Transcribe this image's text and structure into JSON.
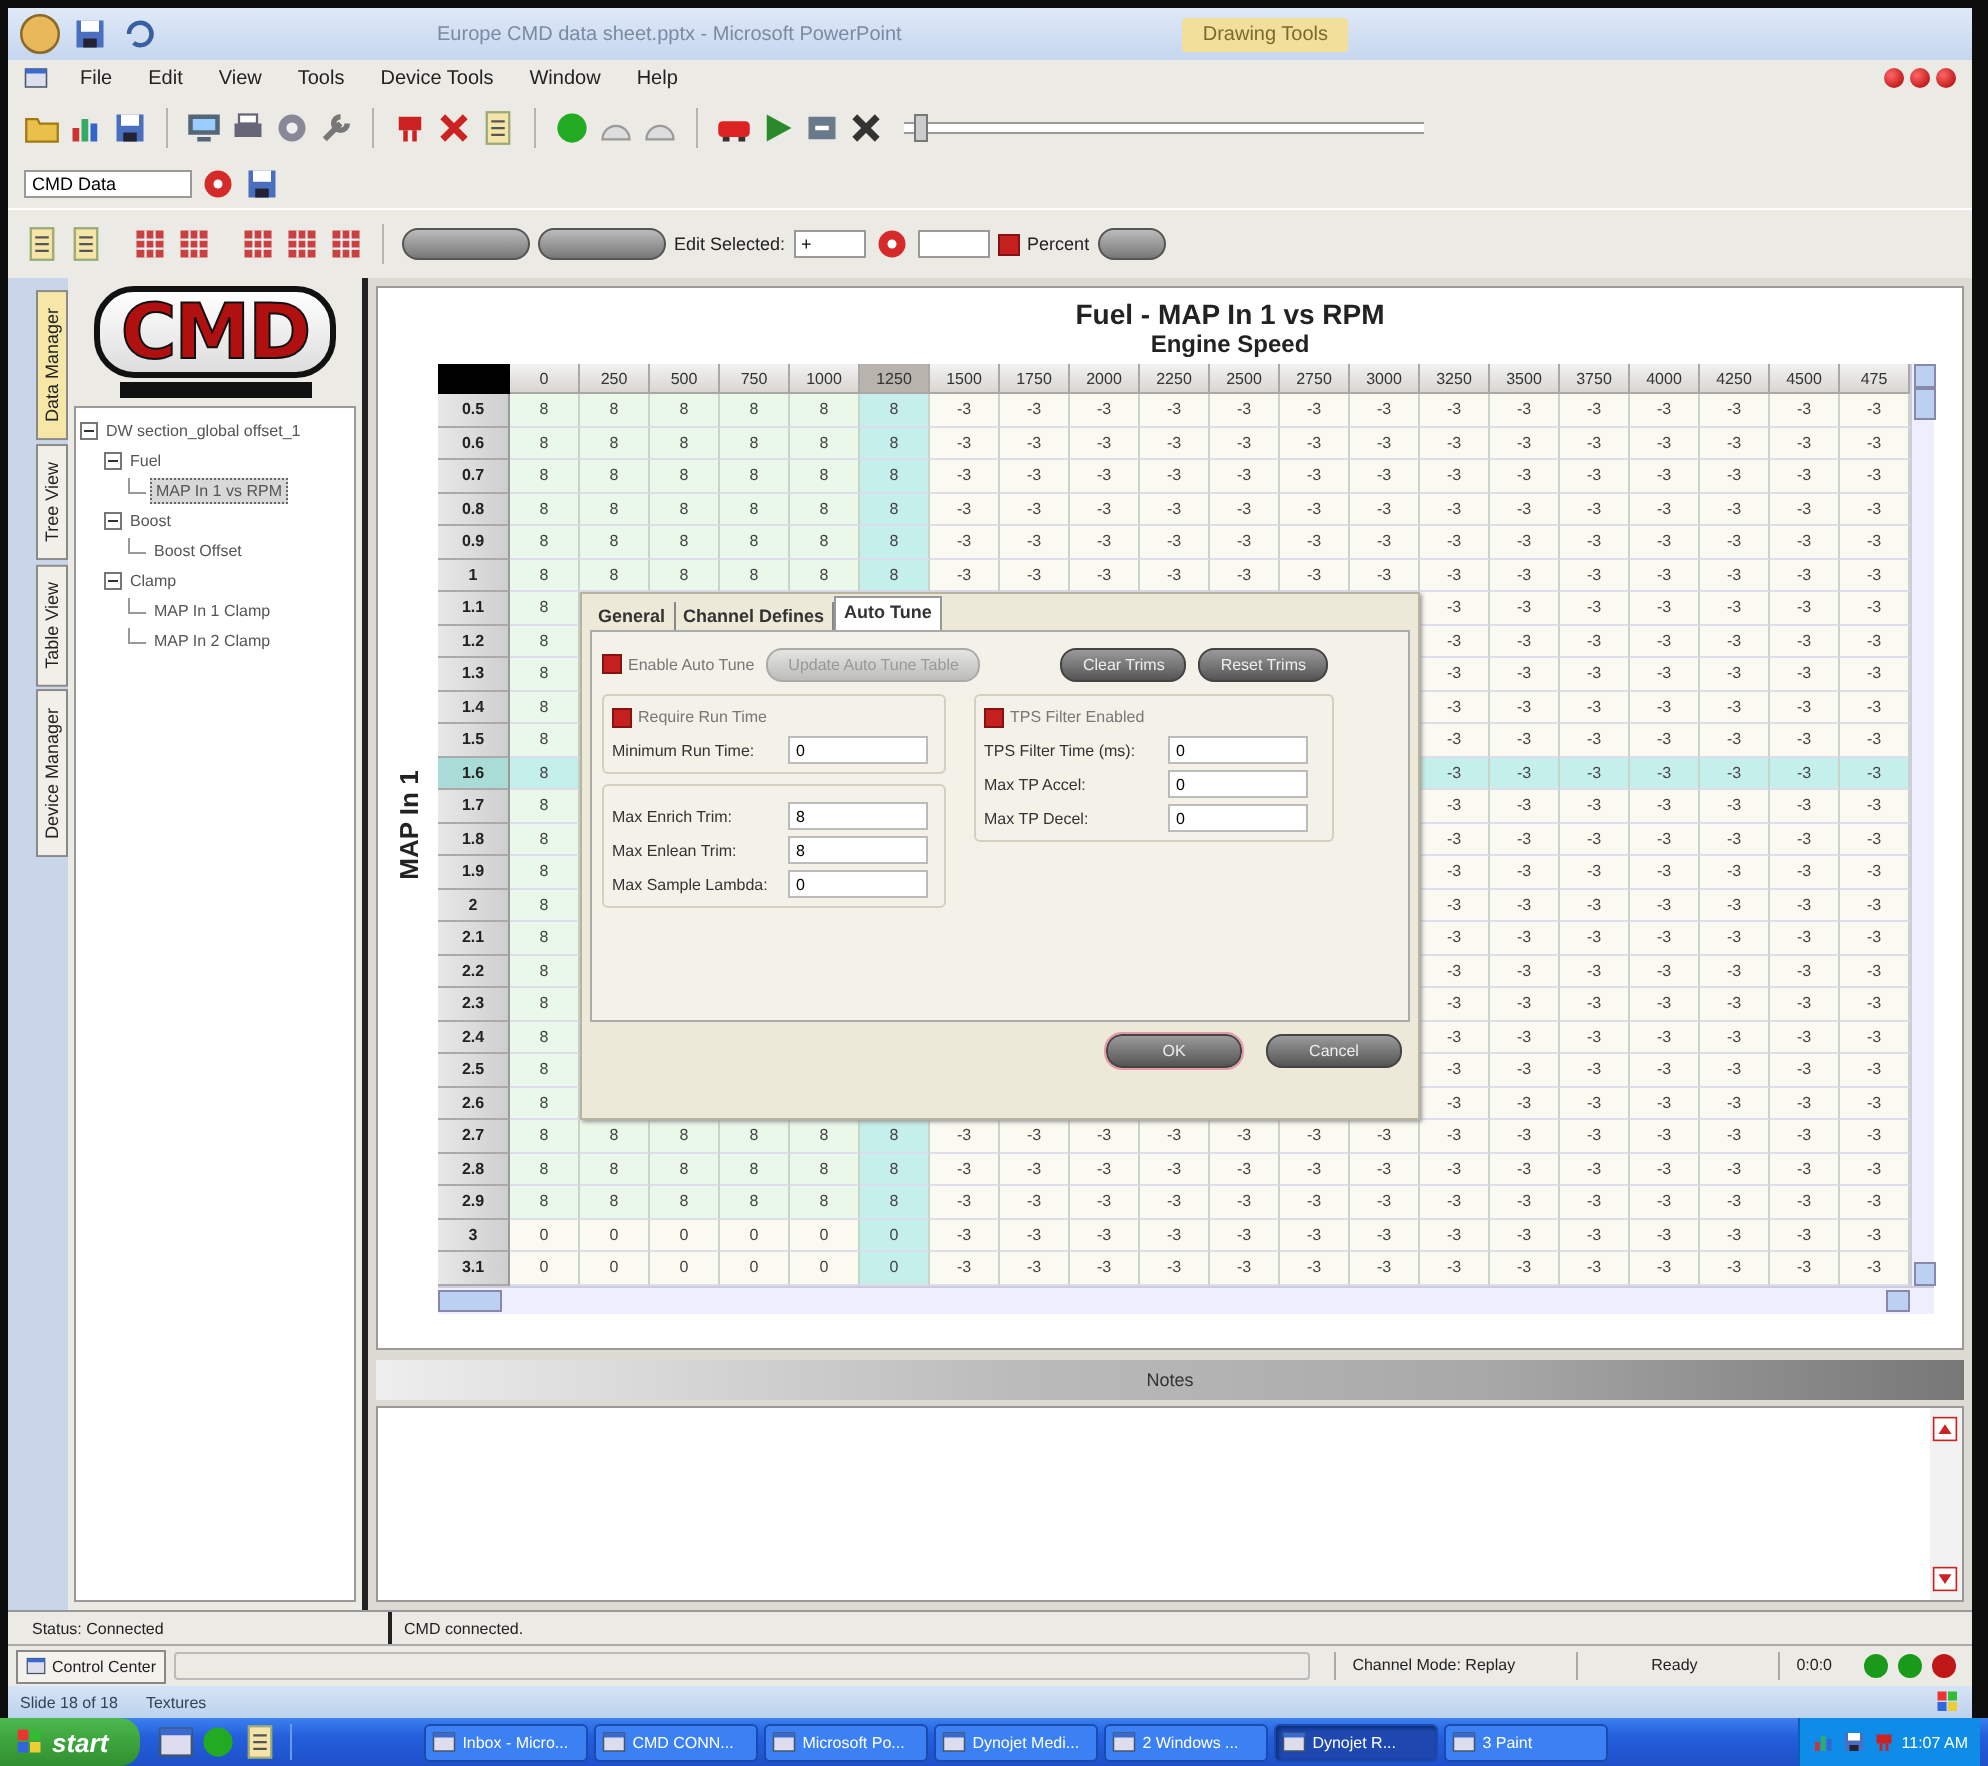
{
  "app_title": "Europe CMD data sheet.pptx - Microsoft PowerPoint",
  "context_tab": "Drawing Tools",
  "menu": [
    "File",
    "Edit",
    "View",
    "Tools",
    "Device Tools",
    "Window",
    "Help"
  ],
  "zoom_slider": {
    "level": 0.02
  },
  "data_selector": {
    "value": "CMD Data"
  },
  "edit_bar": {
    "label": "Edit Selected:",
    "operator": "+",
    "percent": {
      "label": "Percent",
      "checked": true
    }
  },
  "side_tabs": [
    {
      "label": "Data Manager",
      "selected": true
    },
    {
      "label": "Tree View",
      "selected": false
    },
    {
      "label": "Table View",
      "selected": false
    },
    {
      "label": "Device Manager",
      "selected": false
    }
  ],
  "logo": {
    "text": "CMD"
  },
  "tree": [
    {
      "label": "DW section_global offset_1",
      "expanded": true,
      "children": [
        {
          "label": "Fuel",
          "expanded": true,
          "children": [
            {
              "label": "MAP In 1 vs RPM",
              "selected": true
            }
          ]
        },
        {
          "label": "Boost",
          "expanded": true,
          "children": [
            {
              "label": "Boost Offset",
              "selected": false
            }
          ]
        },
        {
          "label": "Clamp",
          "expanded": true,
          "children": [
            {
              "label": "MAP In 1 Clamp",
              "selected": false
            },
            {
              "label": "MAP In 2 Clamp",
              "selected": false
            }
          ]
        }
      ]
    }
  ],
  "table": {
    "title": "Fuel - MAP In 1 vs RPM",
    "x_axis_label": "Engine Speed",
    "y_axis_label": "MAP In 1",
    "columns": [
      {
        "label": "0",
        "selected": false
      },
      {
        "label": "250",
        "selected": false
      },
      {
        "label": "500",
        "selected": false
      },
      {
        "label": "750",
        "selected": false
      },
      {
        "label": "1000",
        "selected": false
      },
      {
        "label": "1250",
        "selected": true
      },
      {
        "label": "1500",
        "selected": false
      },
      {
        "label": "1750",
        "selected": false
      },
      {
        "label": "2000",
        "selected": false
      },
      {
        "label": "2250",
        "selected": false
      },
      {
        "label": "2500",
        "selected": false
      },
      {
        "label": "2750",
        "selected": false
      },
      {
        "label": "3000",
        "selected": false
      },
      {
        "label": "3250",
        "selected": false
      },
      {
        "label": "3500",
        "selected": false
      },
      {
        "label": "3750",
        "selected": false
      },
      {
        "label": "4000",
        "selected": false
      },
      {
        "label": "4250",
        "selected": false
      },
      {
        "label": "4500",
        "selected": false
      },
      {
        "label": "475",
        "selected": false
      }
    ],
    "rows": [
      {
        "label": "0.5",
        "selected": false,
        "cells": [
          "8",
          "8",
          "8",
          "8",
          "8",
          "8",
          "-3",
          "-3",
          "-3",
          "-3",
          "-3",
          "-3",
          "-3",
          "-3",
          "-3",
          "-3",
          "-3",
          "-3",
          "-3",
          "-3"
        ]
      },
      {
        "label": "0.6",
        "selected": false,
        "cells": [
          "8",
          "8",
          "8",
          "8",
          "8",
          "8",
          "-3",
          "-3",
          "-3",
          "-3",
          "-3",
          "-3",
          "-3",
          "-3",
          "-3",
          "-3",
          "-3",
          "-3",
          "-3",
          "-3"
        ]
      },
      {
        "label": "0.7",
        "selected": false,
        "cells": [
          "8",
          "8",
          "8",
          "8",
          "8",
          "8",
          "-3",
          "-3",
          "-3",
          "-3",
          "-3",
          "-3",
          "-3",
          "-3",
          "-3",
          "-3",
          "-3",
          "-3",
          "-3",
          "-3"
        ]
      },
      {
        "label": "0.8",
        "selected": false,
        "cells": [
          "8",
          "8",
          "8",
          "8",
          "8",
          "8",
          "-3",
          "-3",
          "-3",
          "-3",
          "-3",
          "-3",
          "-3",
          "-3",
          "-3",
          "-3",
          "-3",
          "-3",
          "-3",
          "-3"
        ]
      },
      {
        "label": "0.9",
        "selected": false,
        "cells": [
          "8",
          "8",
          "8",
          "8",
          "8",
          "8",
          "-3",
          "-3",
          "-3",
          "-3",
          "-3",
          "-3",
          "-3",
          "-3",
          "-3",
          "-3",
          "-3",
          "-3",
          "-3",
          "-3"
        ]
      },
      {
        "label": "1",
        "selected": false,
        "cells": [
          "8",
          "8",
          "8",
          "8",
          "8",
          "8",
          "-3",
          "-3",
          "-3",
          "-3",
          "-3",
          "-3",
          "-3",
          "-3",
          "-3",
          "-3",
          "-3",
          "-3",
          "-3",
          "-3"
        ]
      },
      {
        "label": "1.1",
        "selected": false,
        "cells": [
          "8",
          null,
          null,
          null,
          null,
          null,
          null,
          null,
          null,
          null,
          null,
          null,
          null,
          "-3",
          "-3",
          "-3",
          "-3",
          "-3",
          "-3",
          "-3"
        ]
      },
      {
        "label": "1.2",
        "selected": false,
        "cells": [
          "8",
          null,
          null,
          null,
          null,
          null,
          null,
          null,
          null,
          null,
          null,
          null,
          null,
          "-3",
          "-3",
          "-3",
          "-3",
          "-3",
          "-3",
          "-3"
        ]
      },
      {
        "label": "1.3",
        "selected": false,
        "cells": [
          "8",
          null,
          null,
          null,
          null,
          null,
          null,
          null,
          null,
          null,
          null,
          null,
          null,
          "-3",
          "-3",
          "-3",
          "-3",
          "-3",
          "-3",
          "-3"
        ]
      },
      {
        "label": "1.4",
        "selected": false,
        "cells": [
          "8",
          null,
          null,
          null,
          null,
          null,
          null,
          null,
          null,
          null,
          null,
          null,
          null,
          "-3",
          "-3",
          "-3",
          "-3",
          "-3",
          "-3",
          "-3"
        ]
      },
      {
        "label": "1.5",
        "selected": false,
        "cells": [
          "8",
          null,
          null,
          null,
          null,
          null,
          null,
          null,
          null,
          null,
          null,
          null,
          null,
          "-3",
          "-3",
          "-3",
          "-3",
          "-3",
          "-3",
          "-3"
        ]
      },
      {
        "label": "1.6",
        "selected": true,
        "cells": [
          "8",
          null,
          null,
          null,
          null,
          null,
          null,
          null,
          null,
          null,
          null,
          null,
          null,
          "-3",
          "-3",
          "-3",
          "-3",
          "-3",
          "-3",
          "-3"
        ]
      },
      {
        "label": "1.7",
        "selected": false,
        "cells": [
          "8",
          null,
          null,
          null,
          null,
          null,
          null,
          null,
          null,
          null,
          null,
          null,
          null,
          "-3",
          "-3",
          "-3",
          "-3",
          "-3",
          "-3",
          "-3"
        ]
      },
      {
        "label": "1.8",
        "selected": false,
        "cells": [
          "8",
          null,
          null,
          null,
          null,
          null,
          null,
          null,
          null,
          null,
          null,
          null,
          null,
          "-3",
          "-3",
          "-3",
          "-3",
          "-3",
          "-3",
          "-3"
        ]
      },
      {
        "label": "1.9",
        "selected": false,
        "cells": [
          "8",
          null,
          null,
          null,
          null,
          null,
          null,
          null,
          null,
          null,
          null,
          null,
          null,
          "-3",
          "-3",
          "-3",
          "-3",
          "-3",
          "-3",
          "-3"
        ]
      },
      {
        "label": "2",
        "selected": false,
        "cells": [
          "8",
          null,
          null,
          null,
          null,
          null,
          null,
          null,
          null,
          null,
          null,
          null,
          null,
          "-3",
          "-3",
          "-3",
          "-3",
          "-3",
          "-3",
          "-3"
        ]
      },
      {
        "label": "2.1",
        "selected": false,
        "cells": [
          "8",
          null,
          null,
          null,
          null,
          null,
          null,
          null,
          null,
          null,
          null,
          null,
          null,
          "-3",
          "-3",
          "-3",
          "-3",
          "-3",
          "-3",
          "-3"
        ]
      },
      {
        "label": "2.2",
        "selected": false,
        "cells": [
          "8",
          null,
          null,
          null,
          null,
          null,
          null,
          null,
          null,
          null,
          null,
          null,
          null,
          "-3",
          "-3",
          "-3",
          "-3",
          "-3",
          "-3",
          "-3"
        ]
      },
      {
        "label": "2.3",
        "selected": false,
        "cells": [
          "8",
          null,
          null,
          null,
          null,
          null,
          null,
          null,
          null,
          null,
          null,
          null,
          null,
          "-3",
          "-3",
          "-3",
          "-3",
          "-3",
          "-3",
          "-3"
        ]
      },
      {
        "label": "2.4",
        "selected": false,
        "cells": [
          "8",
          null,
          null,
          null,
          null,
          null,
          null,
          null,
          null,
          null,
          null,
          null,
          null,
          "-3",
          "-3",
          "-3",
          "-3",
          "-3",
          "-3",
          "-3"
        ]
      },
      {
        "label": "2.5",
        "selected": false,
        "cells": [
          "8",
          null,
          null,
          null,
          null,
          null,
          null,
          null,
          null,
          null,
          null,
          null,
          null,
          "-3",
          "-3",
          "-3",
          "-3",
          "-3",
          "-3",
          "-3"
        ]
      },
      {
        "label": "2.6",
        "selected": false,
        "cells": [
          "8",
          null,
          null,
          null,
          null,
          null,
          null,
          null,
          null,
          null,
          null,
          null,
          null,
          "-3",
          "-3",
          "-3",
          "-3",
          "-3",
          "-3",
          "-3"
        ]
      },
      {
        "label": "2.7",
        "selected": false,
        "cells": [
          "8",
          "8",
          "8",
          "8",
          "8",
          "8",
          "-3",
          "-3",
          "-3",
          "-3",
          "-3",
          "-3",
          "-3",
          "-3",
          "-3",
          "-3",
          "-3",
          "-3",
          "-3",
          "-3"
        ]
      },
      {
        "label": "2.8",
        "selected": false,
        "cells": [
          "8",
          "8",
          "8",
          "8",
          "8",
          "8",
          "-3",
          "-3",
          "-3",
          "-3",
          "-3",
          "-3",
          "-3",
          "-3",
          "-3",
          "-3",
          "-3",
          "-3",
          "-3",
          "-3"
        ]
      },
      {
        "label": "2.9",
        "selected": false,
        "cells": [
          "8",
          "8",
          "8",
          "8",
          "8",
          "8",
          "-3",
          "-3",
          "-3",
          "-3",
          "-3",
          "-3",
          "-3",
          "-3",
          "-3",
          "-3",
          "-3",
          "-3",
          "-3",
          "-3"
        ]
      },
      {
        "label": "3",
        "selected": false,
        "cells": [
          "0",
          "0",
          "0",
          "0",
          "0",
          "0",
          "-3",
          "-3",
          "-3",
          "-3",
          "-3",
          "-3",
          "-3",
          "-3",
          "-3",
          "-3",
          "-3",
          "-3",
          "-3",
          "-3"
        ]
      },
      {
        "label": "3.1",
        "selected": false,
        "cells": [
          "0",
          "0",
          "0",
          "0",
          "0",
          "0",
          "-3",
          "-3",
          "-3",
          "-3",
          "-3",
          "-3",
          "-3",
          "-3",
          "-3",
          "-3",
          "-3",
          "-3",
          "-3",
          "-3"
        ]
      }
    ]
  },
  "auto_tune_dialog": {
    "tabs": [
      {
        "label": "General",
        "selected": false
      },
      {
        "label": "Channel Defines",
        "selected": false
      },
      {
        "label": "Auto Tune",
        "selected": true
      }
    ],
    "enable": {
      "label": "Enable Auto Tune",
      "checked": true
    },
    "buttons": [
      {
        "label": "Update Auto Tune Table",
        "disabled": true
      },
      {
        "label": "Clear Trims",
        "disabled": false
      },
      {
        "label": "Reset Trims",
        "disabled": false
      }
    ],
    "run_time": {
      "label": "Require Run Time",
      "checked": true,
      "fields": [
        {
          "label": "Minimum Run Time:",
          "value": "0"
        }
      ]
    },
    "trims": {
      "fields": [
        {
          "label": "Max Enrich Trim:",
          "value": "8"
        },
        {
          "label": "Max Enlean Trim:",
          "value": "8"
        },
        {
          "label": "Max Sample Lambda:",
          "value": "0"
        }
      ]
    },
    "tps": {
      "label": "TPS Filter Enabled",
      "checked": true,
      "fields": [
        {
          "label": "TPS Filter Time (ms):",
          "value": "0"
        },
        {
          "label": "Max TP Accel:",
          "value": "0"
        },
        {
          "label": "Max TP Decel:",
          "value": "0"
        }
      ]
    },
    "actions": [
      {
        "label": "OK",
        "default": true
      },
      {
        "label": "Cancel",
        "default": false
      }
    ]
  },
  "notes": {
    "title": "Notes"
  },
  "status": {
    "left": "Status: Connected",
    "message": "CMD connected."
  },
  "bottom_bar": {
    "tab": "Control Center",
    "mode": "Channel Mode: Replay",
    "state": "Ready",
    "time": "0:0:0",
    "lights": [
      {
        "color": "#1a9a1a"
      },
      {
        "color": "#1a9a1a"
      },
      {
        "color": "#c01818"
      }
    ]
  },
  "ppt_status": {
    "slide": "Slide 18 of 18",
    "theme": "Textures"
  },
  "taskbar": {
    "start": "start",
    "items": [
      {
        "label": "Inbox - Micro...",
        "selected": false
      },
      {
        "label": "CMD CONN...",
        "selected": false
      },
      {
        "label": "Microsoft Po...",
        "selected": false
      },
      {
        "label": "Dynojet Medi...",
        "selected": false
      },
      {
        "label": "2 Windows ...",
        "selected": false
      },
      {
        "label": "Dynojet R...",
        "selected": true
      },
      {
        "label": "3 Paint",
        "selected": false
      }
    ],
    "clock": "11:07 AM"
  }
}
